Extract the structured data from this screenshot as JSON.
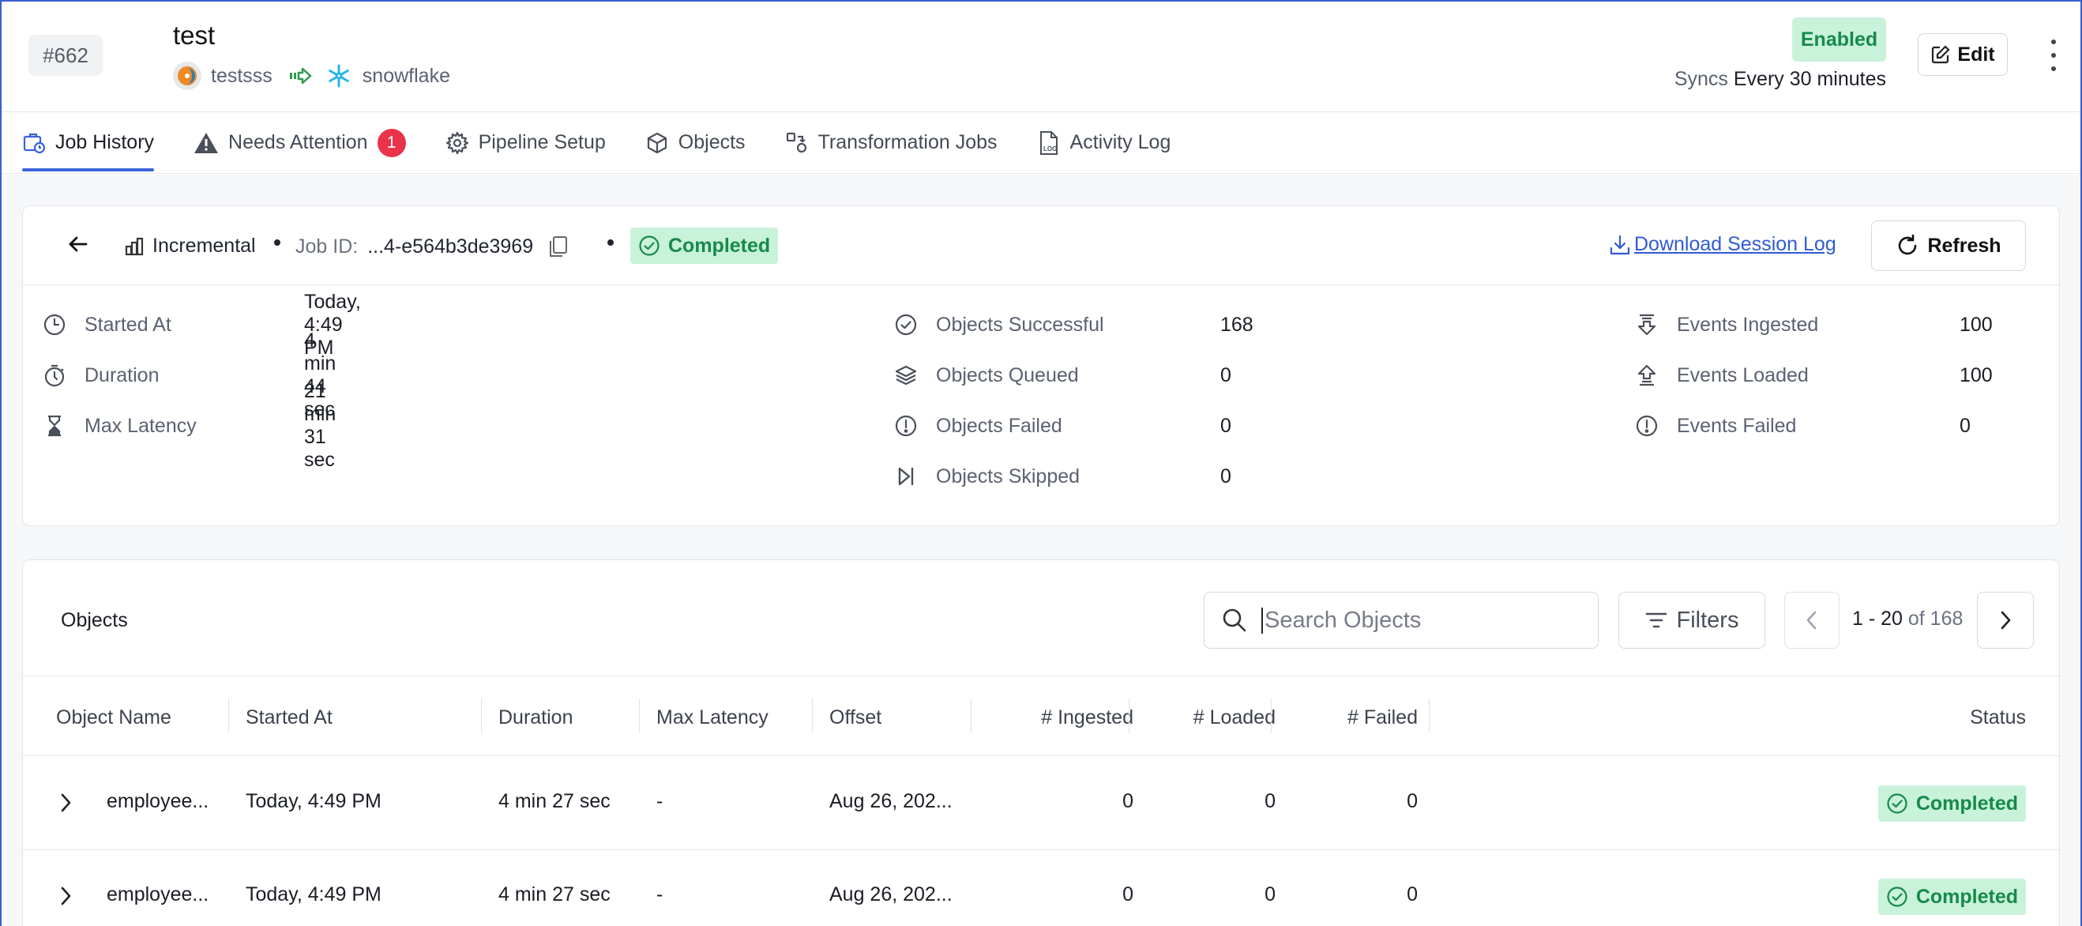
{
  "header": {
    "pipeline_id": "#662",
    "title": "test",
    "source_name": "testsss",
    "destination_name": "snowflake",
    "status_badge": "Enabled",
    "syncs_label": "Syncs",
    "syncs_value": "Every 30 minutes",
    "edit_label": "Edit"
  },
  "tabs": [
    {
      "label": "Job History",
      "icon": "briefcase-clock-icon",
      "active": true
    },
    {
      "label": "Needs Attention",
      "icon": "warning-icon",
      "count": "1"
    },
    {
      "label": "Pipeline Setup",
      "icon": "gear-icon"
    },
    {
      "label": "Objects",
      "icon": "cube-icon"
    },
    {
      "label": "Transformation Jobs",
      "icon": "transform-icon"
    },
    {
      "label": "Activity Log",
      "icon": "log-file-icon"
    }
  ],
  "job": {
    "type": "Incremental",
    "job_id_label": "Job ID:",
    "job_id": "...4-e564b3de3969",
    "status": "Completed",
    "download_label": "Download Session Log",
    "refresh_label": "Refresh",
    "stats_left": [
      {
        "label": "Started At",
        "value": "Today, 4:49 PM",
        "icon": "clock-icon"
      },
      {
        "label": "Duration",
        "value": "4 min 44 sec",
        "icon": "stopwatch-icon"
      },
      {
        "label": "Max Latency",
        "value": "21 min 31 sec",
        "icon": "hourglass-icon"
      }
    ],
    "stats_mid": [
      {
        "label": "Objects Successful",
        "value": "168",
        "icon": "check-circle-icon"
      },
      {
        "label": "Objects Queued",
        "value": "0",
        "icon": "layers-icon"
      },
      {
        "label": "Objects Failed",
        "value": "0",
        "icon": "alert-circle-icon"
      },
      {
        "label": "Objects Skipped",
        "value": "0",
        "icon": "skip-icon"
      }
    ],
    "stats_right": [
      {
        "label": "Events Ingested",
        "value": "100",
        "icon": "ingest-icon"
      },
      {
        "label": "Events Loaded",
        "value": "100",
        "icon": "load-icon"
      },
      {
        "label": "Events Failed",
        "value": "0",
        "icon": "alert-circle-icon"
      }
    ]
  },
  "objects": {
    "title": "Objects",
    "search_placeholder": "Search Objects",
    "filters_label": "Filters",
    "page_range": "1 - 20",
    "page_of": "of 168",
    "columns": [
      "Object Name",
      "Started At",
      "Duration",
      "Max Latency",
      "Offset",
      "# Ingested",
      "# Loaded",
      "# Failed",
      "Status"
    ],
    "rows": [
      {
        "name": "employee...",
        "started": "Today, 4:49 PM",
        "duration": "4 min 27 sec",
        "latency": "-",
        "offset": "Aug 26, 202...",
        "ingested": "0",
        "loaded": "0",
        "failed": "0",
        "status": "Completed"
      },
      {
        "name": "employee...",
        "started": "Today, 4:49 PM",
        "duration": "4 min 27 sec",
        "latency": "-",
        "offset": "Aug 26, 202...",
        "ingested": "0",
        "loaded": "0",
        "failed": "0",
        "status": "Completed"
      }
    ]
  },
  "colors": {
    "accent": "#3b63d8",
    "success_bg": "#c9f2da",
    "success_text": "#168a4a",
    "alert_badge": "#e8334a",
    "link": "#2f5bd6"
  }
}
